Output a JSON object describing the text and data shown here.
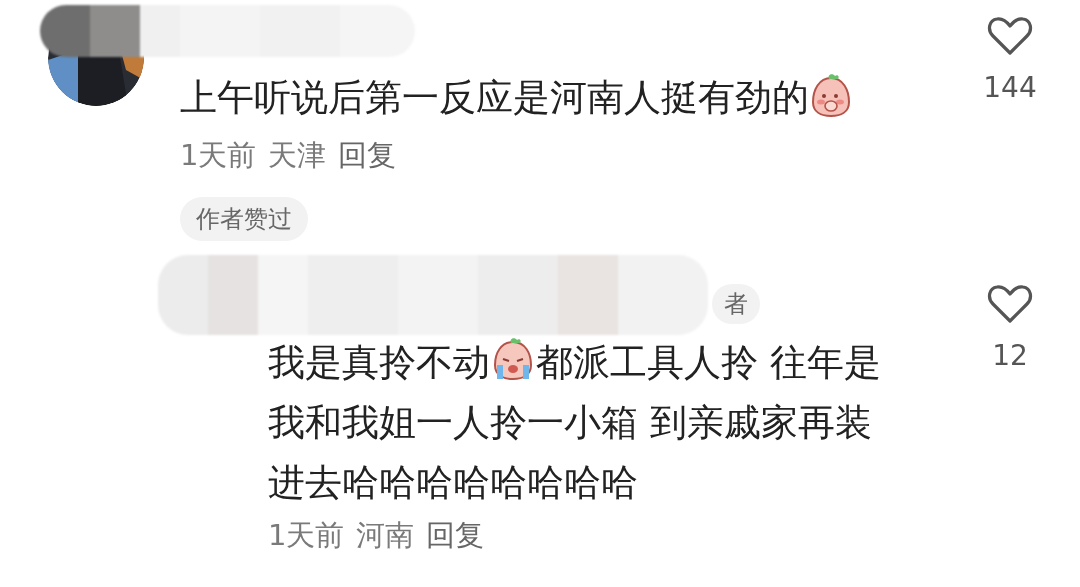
{
  "comments": [
    {
      "segments": [
        {
          "kind": "text",
          "text": "上午听说后第一反应是河南人挺有劲的"
        },
        {
          "kind": "shy"
        }
      ],
      "time": "1天前",
      "place": "天津",
      "reply": "回复",
      "likes": "144",
      "liked_by_author": "作者赞过"
    },
    {
      "author_badge": "者",
      "segments": [
        {
          "kind": "text",
          "text": "我是真拎不动"
        },
        {
          "kind": "cry"
        },
        {
          "kind": "text",
          "text": "都派工具人拎 往年是我和我姐一人拎一小箱 到亲戚家再装进去哈哈哈哈哈哈哈哈"
        }
      ],
      "time": "1天前",
      "place": "河南",
      "reply": "回复",
      "likes": "12"
    }
  ]
}
